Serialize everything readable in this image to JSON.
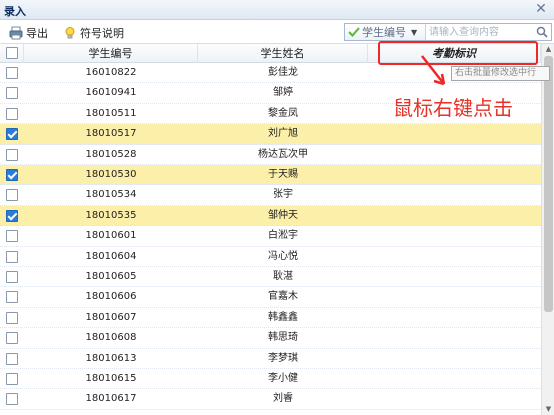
{
  "window": {
    "title": "录入",
    "close_glyph": "✕"
  },
  "toolbar": {
    "export_label": "导出",
    "legend_label": "符号说明"
  },
  "search": {
    "field_label": "学生编号",
    "placeholder": "请输入查询内容",
    "value": ""
  },
  "columns": [
    "学生编号",
    "学生姓名",
    "考勤标识"
  ],
  "rows": [
    {
      "id": "16010822",
      "name": "彭佳龙",
      "checked": false
    },
    {
      "id": "16010941",
      "name": "邹婷",
      "checked": false
    },
    {
      "id": "18010511",
      "name": "黎金凤",
      "checked": false
    },
    {
      "id": "18010517",
      "name": "刘广旭",
      "checked": true
    },
    {
      "id": "18010528",
      "name": "杨达瓦次甲",
      "checked": false
    },
    {
      "id": "18010530",
      "name": "于天赐",
      "checked": true
    },
    {
      "id": "18010534",
      "name": "张宇",
      "checked": false
    },
    {
      "id": "18010535",
      "name": "邹仲天",
      "checked": true
    },
    {
      "id": "18010601",
      "name": "白淞宇",
      "checked": false
    },
    {
      "id": "18010604",
      "name": "冯心悦",
      "checked": false
    },
    {
      "id": "18010605",
      "name": "耿湛",
      "checked": false
    },
    {
      "id": "18010606",
      "name": "官嘉木",
      "checked": false
    },
    {
      "id": "18010607",
      "name": "韩鑫鑫",
      "checked": false
    },
    {
      "id": "18010608",
      "name": "韩思琦",
      "checked": false
    },
    {
      "id": "18010613",
      "name": "李梦琪",
      "checked": false
    },
    {
      "id": "18010615",
      "name": "李小健",
      "checked": false
    },
    {
      "id": "18010617",
      "name": "刘睿",
      "checked": false
    }
  ],
  "tooltip": "右击批量修改选中行",
  "annotation": "鼠标右键点击",
  "colors": {
    "selected_row": "#fbefa9",
    "annotation_red": "#ee2727",
    "checkbox_on": "#2a7bde"
  },
  "icons": {
    "export": "printer-export-icon",
    "legend": "lightbulb-icon",
    "field": "checkmark-icon",
    "search": "magnifier-icon"
  }
}
